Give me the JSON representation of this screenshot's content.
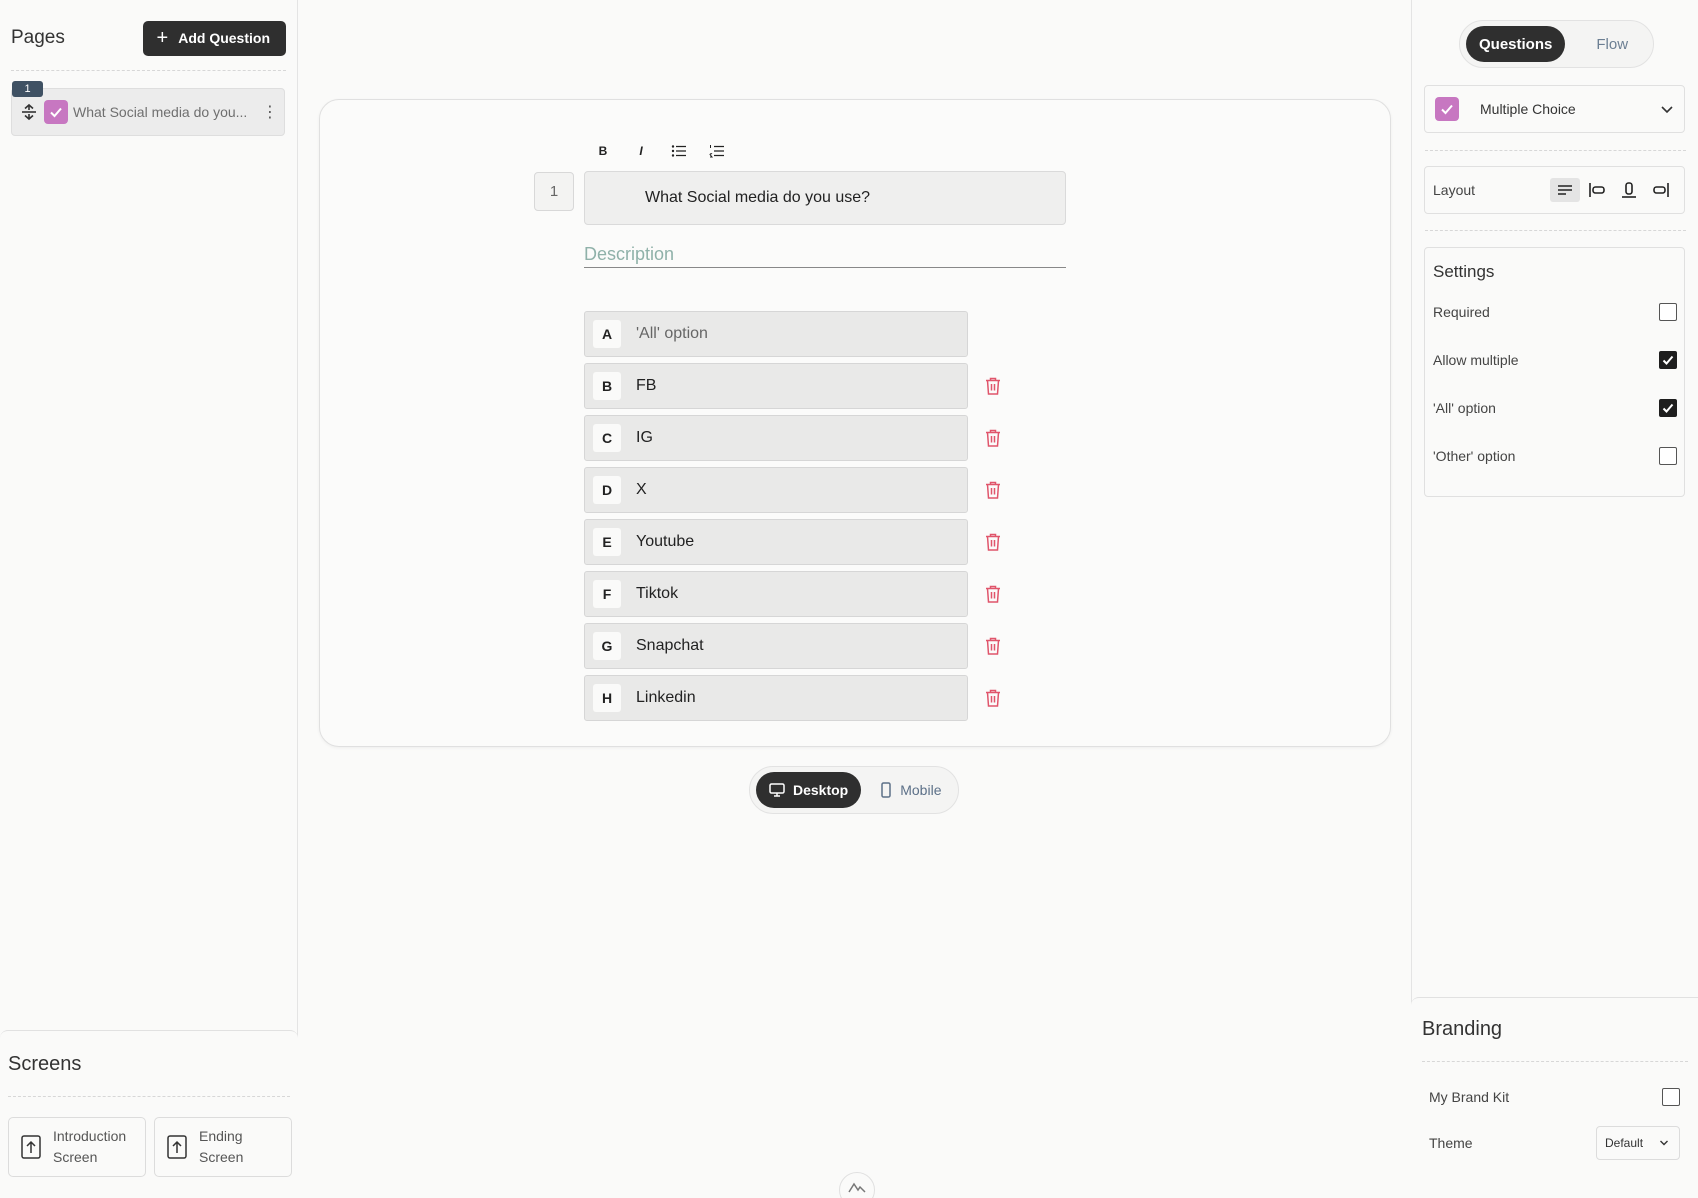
{
  "left": {
    "pages_title": "Pages",
    "add_question_label": "Add Question",
    "page_items": [
      {
        "number": "1",
        "text": "What Social media do you..."
      }
    ],
    "screens_title": "Screens",
    "screens": [
      {
        "line1": "Introduction",
        "line2": "Screen"
      },
      {
        "line1": "Ending",
        "line2": "Screen"
      }
    ]
  },
  "editor": {
    "toolbar": {
      "bold": "B",
      "italic": "I"
    },
    "question_number": "1",
    "question_text": "What Social media do you use?",
    "description_placeholder": "Description",
    "options": [
      {
        "key": "A",
        "text": "'All' option",
        "deletable": false
      },
      {
        "key": "B",
        "text": "FB",
        "deletable": true
      },
      {
        "key": "C",
        "text": "IG",
        "deletable": true
      },
      {
        "key": "D",
        "text": "X",
        "deletable": true
      },
      {
        "key": "E",
        "text": "Youtube",
        "deletable": true
      },
      {
        "key": "F",
        "text": "Tiktok",
        "deletable": true
      },
      {
        "key": "G",
        "text": "Snapchat",
        "deletable": true
      },
      {
        "key": "H",
        "text": "Linkedin",
        "deletable": true
      }
    ],
    "device_toggle": {
      "desktop": "Desktop",
      "mobile": "Mobile",
      "selected": "Desktop"
    }
  },
  "right": {
    "tabs": {
      "questions": "Questions",
      "flow": "Flow",
      "selected": "Questions"
    },
    "question_type": "Multiple Choice",
    "layout_label": "Layout",
    "settings_title": "Settings",
    "settings": [
      {
        "label": "Required",
        "checked": false
      },
      {
        "label": "Allow multiple",
        "checked": true
      },
      {
        "label": "'All' option",
        "checked": true
      },
      {
        "label": "'Other' option",
        "checked": false
      }
    ],
    "branding_title": "Branding",
    "brand_kit_label": "My Brand Kit",
    "brand_kit_checked": false,
    "theme_label": "Theme",
    "theme_value": "Default"
  },
  "colors": {
    "accent_pink": "#c777c1",
    "dark": "#2f2f2f",
    "trash_red": "#e0556b",
    "description_teal": "#8fb1a9"
  },
  "icons": [
    "plus-icon",
    "drag-handle-icon",
    "checkbox-icon",
    "kebab-icon",
    "trash-icon",
    "monitor-icon",
    "phone-icon",
    "chevron-down-icon",
    "screen-upload-icon"
  ]
}
